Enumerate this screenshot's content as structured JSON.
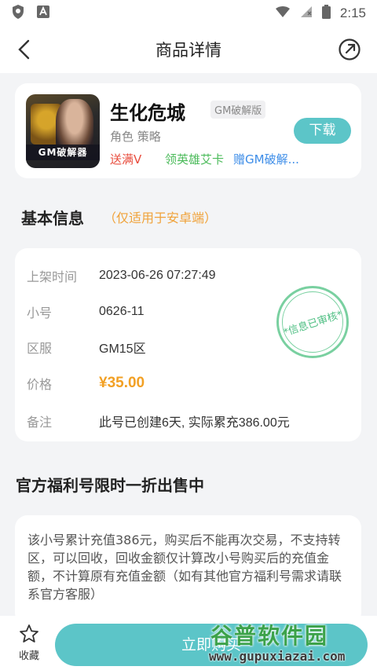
{
  "status_bar": {
    "time": "2:15"
  },
  "header": {
    "title": "商品详情"
  },
  "game": {
    "thumb_text": "GM破解器",
    "name": "生化危城",
    "tag": "GM破解版",
    "category": "角色 策略",
    "perks": [
      "送满V",
      "领英雄艾卡",
      "赠GM破解..."
    ],
    "download_label": "下载"
  },
  "basic": {
    "title": "基本信息",
    "note": "（仅适用于安卓端）",
    "rows": [
      {
        "label": "上架时间",
        "value": "2023-06-26 07:27:49"
      },
      {
        "label": "小号",
        "value": "0626-11"
      },
      {
        "label": "区服",
        "value": "GM15区"
      },
      {
        "label": "价格",
        "value": "¥35.00"
      },
      {
        "label": "备注",
        "value": "此号已创建6天, 实际累充386.00元"
      }
    ],
    "stamp": "*信息已审核*"
  },
  "promo": {
    "title": "官方福利号限时一折出售中",
    "description": "该小号累计充值386元，购买后不能再次交易，不支持转区，可以回收，回收金额仅计算改小号购买后的充值金额，不计算原有充值金额（如有其他官方福利号需求请联系官方客服）"
  },
  "bottom": {
    "favorite_label": "收藏",
    "buy_label": "立即购买"
  },
  "watermark": {
    "title": "谷普软件园",
    "url": "www.gupuxiazai.com"
  },
  "colors": {
    "accent": "#5cc5c8",
    "price": "#f2a024",
    "perk_red": "#e84c3d",
    "perk_green": "#4cbb5b",
    "perk_blue": "#3d8de8",
    "note_orange": "#f0a23a"
  }
}
